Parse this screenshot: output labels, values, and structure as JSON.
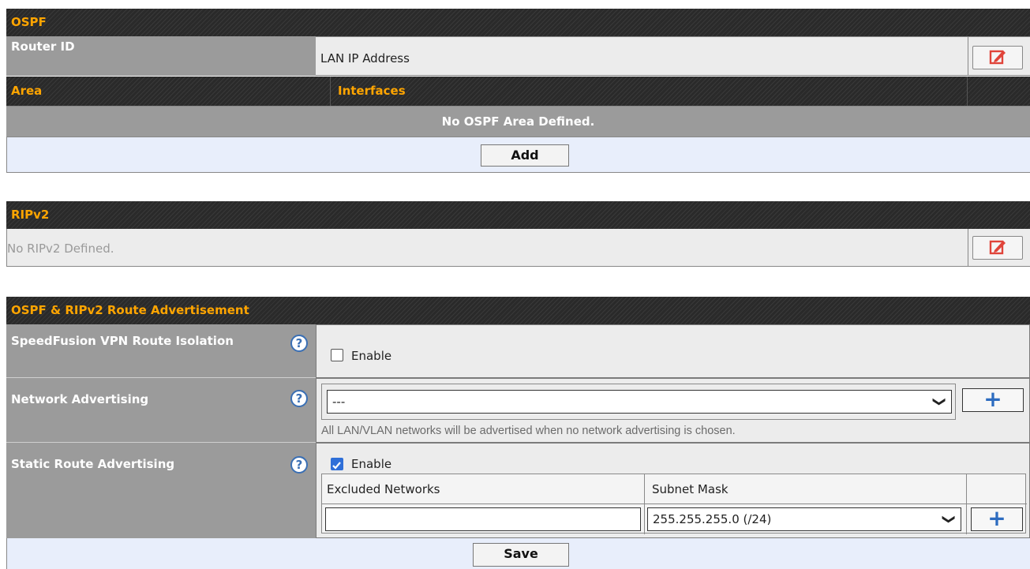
{
  "ospf": {
    "title": "OSPF",
    "router_id_label": "Router ID",
    "router_id_value": "LAN IP Address",
    "area_header": "Area",
    "interfaces_header": "Interfaces",
    "empty_message": "No OSPF Area Defined.",
    "add_label": "Add"
  },
  "ripv2": {
    "title": "RIPv2",
    "empty_message": "No RIPv2 Defined."
  },
  "advert": {
    "title": "OSPF & RIPv2 Route Advertisement",
    "vpn_isolation_label": "SpeedFusion VPN Route Isolation",
    "vpn_isolation_enable": "Enable",
    "vpn_isolation_checked": false,
    "network_advertising_label": "Network Advertising",
    "network_select_value": "---",
    "network_note": "All LAN/VLAN networks will be advertised when no network advertising is chosen.",
    "static_route_label": "Static Route Advertising",
    "static_route_enable": "Enable",
    "static_route_checked": true,
    "excluded_networks_header": "Excluded Networks",
    "subnet_mask_header": "Subnet Mask",
    "excluded_network_value": "",
    "subnet_mask_value": "255.255.255.0 (/24)",
    "save_label": "Save"
  },
  "icons": {
    "edit": "edit-icon",
    "help": "help-icon",
    "plus": "plus-icon",
    "dropdown": "chevron-down-icon"
  }
}
